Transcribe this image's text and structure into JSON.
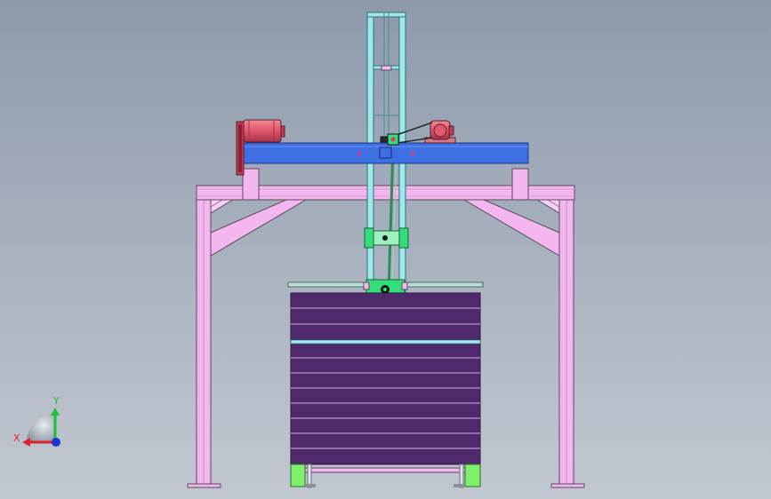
{
  "viewport": {
    "background_top": "#8e9aab",
    "background_bottom": "#c2c8d1"
  },
  "colors": {
    "frame_pink": "#f4b6ee",
    "frame_edge": "#5a4a5a",
    "beam_blue": "#3e6fe3",
    "motor_red": "#e2596e",
    "motor_cap": "#c23a58",
    "mast_cyan": "#9fe9ec",
    "carriage_green": "#31e07a",
    "stack_purple": "#4e2a6d",
    "stack_line": "#c9b8e0",
    "base_green": "#7ef06b",
    "slide_rail": "#c8e8e2"
  },
  "axis_triad": {
    "y_label": "Y",
    "x_label": "X",
    "y_color": "#1fbf3a",
    "x_color": "#e0202a",
    "z_color": "#1a33d6"
  }
}
